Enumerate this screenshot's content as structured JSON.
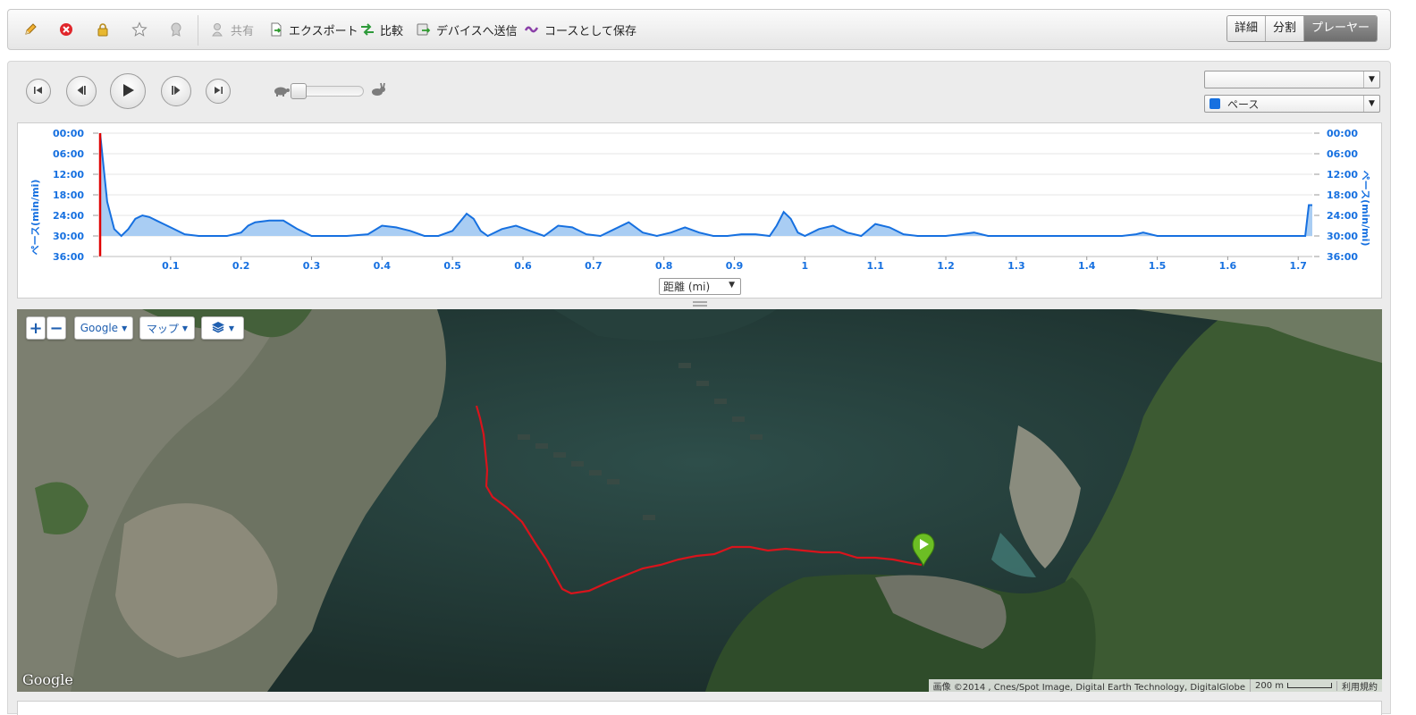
{
  "toolbar": {
    "share": "共有",
    "export": "エクスポート",
    "compare": "比較",
    "send_to_device": "デバイスへ送信",
    "save_as_course": "コースとして保存"
  },
  "view_toggle": {
    "details": "詳細",
    "splits": "分割",
    "player": "プレーヤー"
  },
  "player": {
    "speed_slider": 0
  },
  "selectors": {
    "top_value": "",
    "bottom_value": "ペース",
    "bottom_color": "#1670e0"
  },
  "chart_data": {
    "type": "area",
    "ylabel": "ペース(min/mi)",
    "ylabel_right": "ペース(min/mi)",
    "x_selector": "距離 (mi)",
    "xlim": [
      0,
      1.72
    ],
    "ylim_inverted": [
      0,
      36
    ],
    "x_ticks": [
      "0.1",
      "0.2",
      "0.3",
      "0.4",
      "0.5",
      "0.6",
      "0.7",
      "0.8",
      "0.9",
      "1",
      "1.1",
      "1.2",
      "1.3",
      "1.4",
      "1.5",
      "1.6",
      "1.7"
    ],
    "y_ticks": [
      "00:00",
      "06:00",
      "12:00",
      "18:00",
      "24:00",
      "30:00",
      "36:00"
    ],
    "series": [
      {
        "color": "#1670e0",
        "x": [
          0,
          0.01,
          0.02,
          0.03,
          0.04,
          0.05,
          0.06,
          0.07,
          0.08,
          0.09,
          0.1,
          0.12,
          0.14,
          0.16,
          0.18,
          0.2,
          0.21,
          0.22,
          0.24,
          0.26,
          0.28,
          0.3,
          0.32,
          0.35,
          0.38,
          0.4,
          0.42,
          0.44,
          0.46,
          0.48,
          0.5,
          0.51,
          0.52,
          0.53,
          0.54,
          0.55,
          0.57,
          0.59,
          0.61,
          0.63,
          0.65,
          0.67,
          0.69,
          0.71,
          0.73,
          0.75,
          0.77,
          0.79,
          0.81,
          0.83,
          0.85,
          0.87,
          0.89,
          0.91,
          0.93,
          0.95,
          0.96,
          0.97,
          0.98,
          0.99,
          1.0,
          1.02,
          1.04,
          1.06,
          1.08,
          1.1,
          1.12,
          1.14,
          1.16,
          1.18,
          1.2,
          1.22,
          1.24,
          1.26,
          1.3,
          1.35,
          1.4,
          1.45,
          1.47,
          1.48,
          1.5,
          1.55,
          1.6,
          1.65,
          1.7,
          1.71,
          1.715,
          1.72
        ],
        "y": [
          0,
          20,
          28,
          30,
          28,
          25,
          24,
          24.5,
          25.5,
          26.5,
          27.5,
          29.5,
          30,
          30,
          30,
          29,
          27,
          26,
          25.5,
          25.5,
          28,
          30,
          30,
          30,
          29.5,
          27,
          27.5,
          28.5,
          30,
          30,
          28.5,
          26,
          23.5,
          25,
          28.5,
          30,
          28,
          27,
          28.5,
          30,
          27,
          27.5,
          29.5,
          30,
          28,
          26,
          29,
          30,
          29,
          27.5,
          29,
          30,
          30,
          29.5,
          29.5,
          30,
          27,
          23,
          25,
          29,
          30,
          28,
          27,
          29,
          30,
          26.5,
          27.5,
          29.5,
          30,
          30,
          30,
          29.5,
          29,
          30,
          30,
          30,
          30,
          30,
          29.5,
          29,
          30,
          30,
          30,
          30,
          30,
          30,
          21,
          21
        ]
      }
    ]
  },
  "map": {
    "zoom_in": "+",
    "zoom_out": "−",
    "provider": "Google",
    "map_type": "マップ",
    "attribution": "画像 ©2014 , Cnes/Spot Image, Digital Earth Technology, DigitalGlobe",
    "scale": "200 m",
    "terms": "利用規約",
    "google_logo": "Google"
  }
}
